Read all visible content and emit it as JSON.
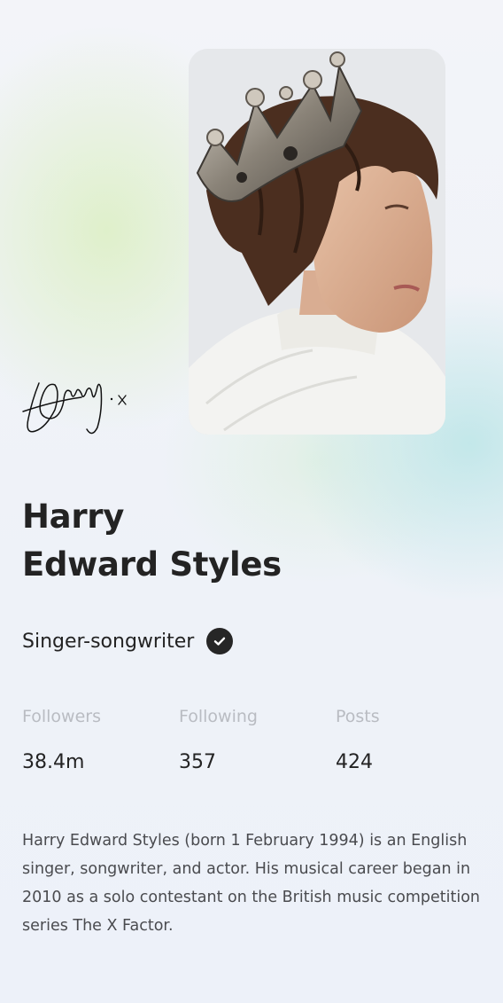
{
  "profile": {
    "name_line1": "Harry",
    "name_line2": "Edward Styles",
    "role": "Singer-songwriter",
    "verified_icon": "check-circle-icon",
    "signature_icon": "handwritten-signature",
    "photo_icon": "portrait-photo"
  },
  "stats": [
    {
      "label": "Followers",
      "value": "38.4m"
    },
    {
      "label": "Following",
      "value": "357"
    },
    {
      "label": "Posts",
      "value": "424"
    }
  ],
  "bio": "Harry Edward Styles (born 1 February 1994) is an English singer, songwriter, and actor. His musical career began in 2010 as a solo contestant on the British music competition series The X Factor.",
  "colors": {
    "text": "#232323",
    "muted": "#b9bcc2",
    "body": "#4a4b4f",
    "background": "#eef1f8"
  }
}
